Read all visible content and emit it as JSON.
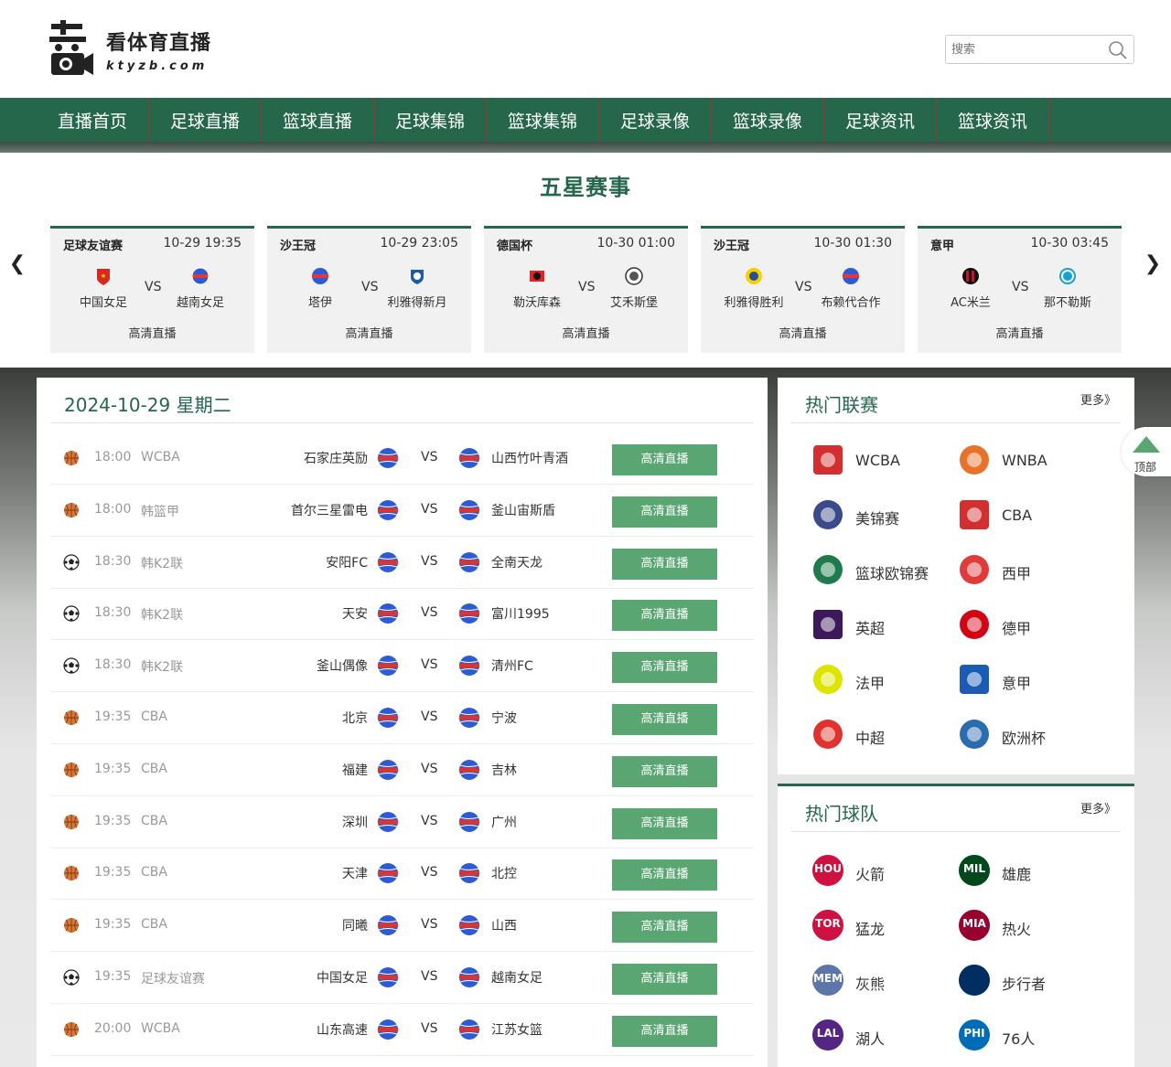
{
  "site": {
    "logo_cn": "看体育直播",
    "logo_en": "ktyzb.com"
  },
  "search": {
    "placeholder": "搜索"
  },
  "nav": {
    "items": [
      "直播首页",
      "足球直播",
      "篮球直播",
      "足球集锦",
      "篮球集锦",
      "足球录像",
      "篮球录像",
      "足球资讯",
      "篮球资讯"
    ]
  },
  "five_star": {
    "title": "五星赛事",
    "cards": [
      {
        "league": "足球友谊赛",
        "time": "10-29 19:35",
        "home": "中国女足",
        "away": "越南女足",
        "vs": "VS",
        "live": "高清直播"
      },
      {
        "league": "沙王冠",
        "time": "10-29 23:05",
        "home": "塔伊",
        "away": "利雅得新月",
        "vs": "VS",
        "live": "高清直播"
      },
      {
        "league": "德国杯",
        "time": "10-30 01:00",
        "home": "勒沃库森",
        "away": "艾禾斯堡",
        "vs": "VS",
        "live": "高清直播"
      },
      {
        "league": "沙王冠",
        "time": "10-30 01:30",
        "home": "利雅得胜利",
        "away": "布赖代合作",
        "vs": "VS",
        "live": "高清直播"
      },
      {
        "league": "意甲",
        "time": "10-30 03:45",
        "home": "AC米兰",
        "away": "那不勒斯",
        "vs": "VS",
        "live": "高清直播"
      }
    ]
  },
  "schedule": {
    "date": "2024-10-29 星期二",
    "rows": [
      {
        "sport": "basketball",
        "time": "18:00",
        "league": "WCBA",
        "home": "石家庄英励",
        "away": "山西竹叶青酒",
        "vs": "VS",
        "btn": "高清直播"
      },
      {
        "sport": "basketball",
        "time": "18:00",
        "league": "韩篮甲",
        "home": "首尔三星雷电",
        "away": "釜山宙斯盾",
        "vs": "VS",
        "btn": "高清直播"
      },
      {
        "sport": "football",
        "time": "18:30",
        "league": "韩K2联",
        "home": "安阳FC",
        "away": "全南天龙",
        "vs": "VS",
        "btn": "高清直播"
      },
      {
        "sport": "football",
        "time": "18:30",
        "league": "韩K2联",
        "home": "天安",
        "away": "富川1995",
        "vs": "VS",
        "btn": "高清直播"
      },
      {
        "sport": "football",
        "time": "18:30",
        "league": "韩K2联",
        "home": "釜山偶像",
        "away": "清州FC",
        "vs": "VS",
        "btn": "高清直播"
      },
      {
        "sport": "basketball",
        "time": "19:35",
        "league": "CBA",
        "home": "北京",
        "away": "宁波",
        "vs": "VS",
        "btn": "高清直播"
      },
      {
        "sport": "basketball",
        "time": "19:35",
        "league": "CBA",
        "home": "福建",
        "away": "吉林",
        "vs": "VS",
        "btn": "高清直播"
      },
      {
        "sport": "basketball",
        "time": "19:35",
        "league": "CBA",
        "home": "深圳",
        "away": "广州",
        "vs": "VS",
        "btn": "高清直播"
      },
      {
        "sport": "basketball",
        "time": "19:35",
        "league": "CBA",
        "home": "天津",
        "away": "北控",
        "vs": "VS",
        "btn": "高清直播"
      },
      {
        "sport": "basketball",
        "time": "19:35",
        "league": "CBA",
        "home": "同曦",
        "away": "山西",
        "vs": "VS",
        "btn": "高清直播"
      },
      {
        "sport": "football",
        "time": "19:35",
        "league": "足球友谊赛",
        "home": "中国女足",
        "away": "越南女足",
        "vs": "VS",
        "btn": "高清直播"
      },
      {
        "sport": "basketball",
        "time": "20:00",
        "league": "WCBA",
        "home": "山东高速",
        "away": "江苏女篮",
        "vs": "VS",
        "btn": "高清直播"
      }
    ]
  },
  "hot_leagues": {
    "title": "热门联赛",
    "more": "更多》",
    "items": [
      "WCBA",
      "WNBA",
      "美锦赛",
      "CBA",
      "篮球欧锦赛",
      "西甲",
      "英超",
      "德甲",
      "法甲",
      "意甲",
      "中超",
      "欧洲杯"
    ]
  },
  "hot_teams": {
    "title": "热门球队",
    "more": "更多》",
    "items": [
      {
        "name": "火箭",
        "abbr": "HOU",
        "color": "#ce1141"
      },
      {
        "name": "雄鹿",
        "abbr": "MIL",
        "color": "#00471b"
      },
      {
        "name": "猛龙",
        "abbr": "TOR",
        "color": "#ce1141"
      },
      {
        "name": "热火",
        "abbr": "MIA",
        "color": "#98002e"
      },
      {
        "name": "灰熊",
        "abbr": "MEM",
        "color": "#5d76a9"
      },
      {
        "name": "步行者",
        "abbr": "",
        "color": "#002d62"
      },
      {
        "name": "湖人",
        "abbr": "LAL",
        "color": "#552583"
      },
      {
        "name": "76人",
        "abbr": "PHI",
        "color": "#006bb6"
      }
    ]
  },
  "totop": {
    "label": "顶部"
  },
  "colors": {
    "brand_green": "#24674a",
    "button_green": "#5aa673",
    "nav_divider": "#a8302a"
  }
}
